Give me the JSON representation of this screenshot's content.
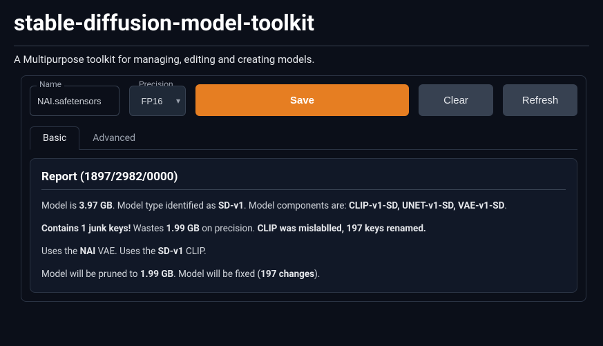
{
  "header": {
    "title": "stable-diffusion-model-toolkit",
    "subtitle": "A Multipurpose toolkit for managing, editing and creating models."
  },
  "form": {
    "name_label": "Name",
    "name_value": "NAI.safetensors",
    "precision_label": "Precision",
    "precision_value": "FP16",
    "save_label": "Save",
    "clear_label": "Clear",
    "refresh_label": "Refresh"
  },
  "tabs": {
    "basic": "Basic",
    "advanced": "Advanced"
  },
  "report": {
    "title": "Report (1897/2982/0000)",
    "counts": {
      "known": 1897,
      "total": 2982,
      "extra": 0
    },
    "model_size_gb": "3.97 GB",
    "model_type": "SD-v1",
    "components": [
      "CLIP-v1-SD",
      "UNET-v1-SD",
      "VAE-v1-SD"
    ],
    "components_joined": "CLIP-v1-SD, UNET-v1-SD, VAE-v1-SD",
    "junk_keys": 1,
    "junk_text": "Contains 1 junk keys!",
    "waste_gb": "1.99 GB",
    "clip_renamed_keys": 197,
    "vae_source": "NAI",
    "clip_source": "SD-v1",
    "prune_target_gb": "1.99 GB",
    "fix_changes": 197,
    "text": {
      "model_is": "Model is ",
      "type_identified": ". Model type identified as ",
      "components_are": ". Model components are: ",
      "wastes": " Wastes ",
      "on_precision": " on precision. ",
      "clip_mislabeled_pre": "CLIP was mislablled, ",
      "clip_mislabeled_post": " keys renamed.",
      "uses_the": "Uses the ",
      "vae_suffix": " VAE. Uses the ",
      "clip_suffix": " CLIP.",
      "pruned_to": "Model will be pruned to ",
      "fixed_pre": ". Model will be fixed (",
      "changes": " changes",
      "close_paren": ")."
    }
  }
}
